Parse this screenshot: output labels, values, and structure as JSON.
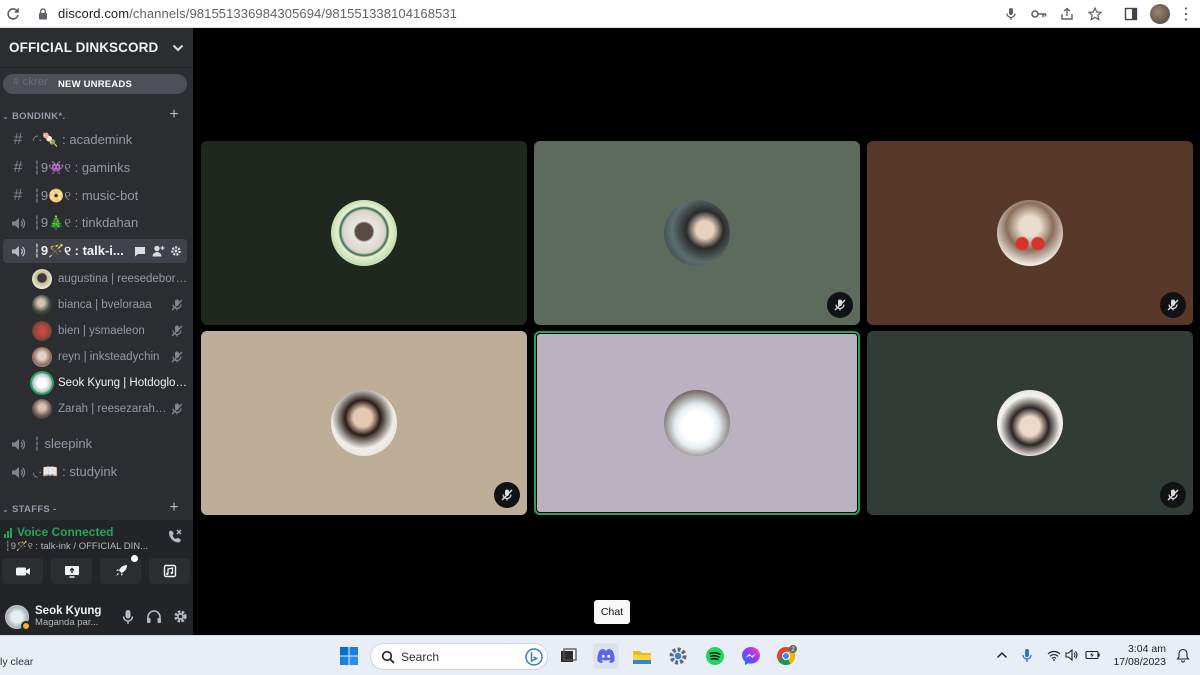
{
  "browser": {
    "url_host": "discord.com",
    "url_path": "/channels/981551336984305694/981551338104168531"
  },
  "server": {
    "name": "OFFICIAL DINKSCORD",
    "new_unreads": "NEW UNREADS",
    "ghost_text": "# ckrer"
  },
  "categories": {
    "bondink": "BONDINK*.",
    "staffs": "STAFFS -"
  },
  "channels": [
    {
      "label": "◜·🍡 : academink",
      "type": "text"
    },
    {
      "label": "┆9👾୧ : gaminks",
      "type": "text"
    },
    {
      "label": "┆9📀୧ : music-bot",
      "type": "text"
    },
    {
      "label": "┆9🎄୧ : tinkdahan",
      "type": "voice"
    },
    {
      "label": "┆9🪄୧ : talk-i...",
      "type": "voice"
    },
    {
      "label": "┆ sleepink",
      "type": "voice"
    },
    {
      "label": "◟·📖 : studyink",
      "type": "voice"
    }
  ],
  "members": [
    {
      "name": "augustina | reesedebora...",
      "muted": false,
      "av": "#c9b48a"
    },
    {
      "name": "bianca | bveloraaa",
      "muted": true,
      "av": "#3d4a40"
    },
    {
      "name": "bien | ysmaeleon",
      "muted": true,
      "av": "#8a4b3a"
    },
    {
      "name": "reyn | inksteadychin",
      "muted": true,
      "av": "#d9b9a4"
    },
    {
      "name": "Seok Kyung | Hotdoglov...",
      "muted": false,
      "av": "#e6ecef"
    },
    {
      "name": "Zarah | reesezarahdo",
      "muted": true,
      "av": "#6e5e58"
    }
  ],
  "voice": {
    "status": "Voice Connected",
    "location": "┆9🪄୧ : talk-ink / OFFICIAL DIN..."
  },
  "user": {
    "name": "Seok Kyung",
    "status": "Maganda par..."
  },
  "tooltip": "Chat",
  "taskbar": {
    "weather": "ly clear",
    "search_placeholder": "Search",
    "time": "3:04 am",
    "date": "17/08/2023",
    "chrome_badge": "2"
  },
  "colors": {
    "sidebar_bg": "#2b2d31",
    "accent_green": "#23a559",
    "tile1": "#1f271f",
    "tile2": "#5d6b5c",
    "tile3": "#583829",
    "tile4": "#bfae97",
    "tile5": "#bab2c0",
    "tile6": "#323c36"
  }
}
